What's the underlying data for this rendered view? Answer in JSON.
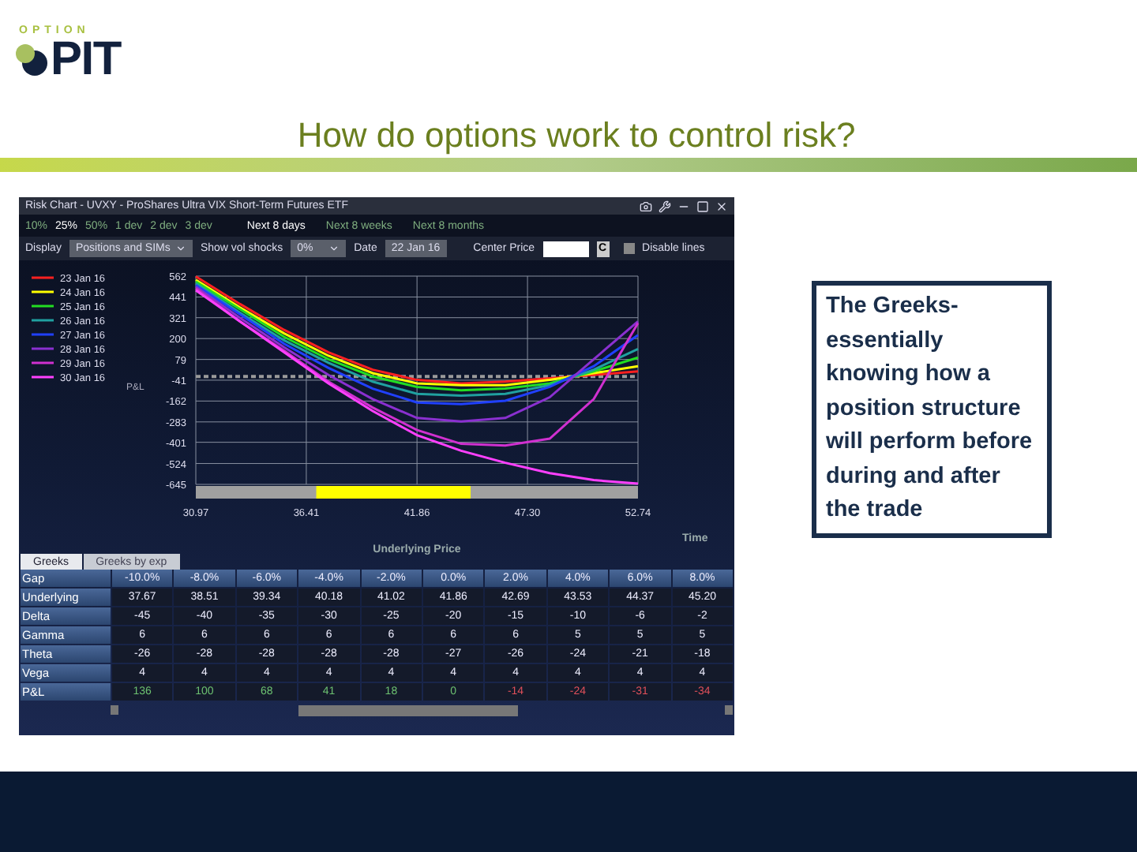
{
  "logo": {
    "top": "OPTION",
    "main": "PIT"
  },
  "title": "How do options work to control risk?",
  "risk_window": {
    "title": "Risk Chart - UVXY - ProShares Ultra VIX Short-Term Futures ETF",
    "ranges": [
      {
        "label": "10%",
        "selected": false
      },
      {
        "label": "25%",
        "selected": true
      },
      {
        "label": "50%",
        "selected": false
      },
      {
        "label": "1 dev",
        "selected": false
      },
      {
        "label": "2 dev",
        "selected": false
      },
      {
        "label": "3 dev",
        "selected": false
      }
    ],
    "horizons": [
      {
        "label": "Next 8 days",
        "selected": true
      },
      {
        "label": "Next 8 weeks",
        "selected": false
      },
      {
        "label": "Next 8 months",
        "selected": false
      }
    ],
    "controls": {
      "display_label": "Display",
      "display_value": "Positions and SIMs",
      "vol_label": "Show vol shocks",
      "vol_value": "0%",
      "date_label": "Date",
      "date_value": "22 Jan 16",
      "center_label": "Center Price",
      "center_button": "C",
      "disable_label": "Disable lines",
      "disable_checked": false
    },
    "chart_data": {
      "type": "line",
      "grid": true,
      "legend": true,
      "ref_lines": [
        {
          "axis": "y",
          "value": -20
        }
      ],
      "xlabel": "Underlying Price",
      "ylabel": "P&L",
      "x": [
        30.97,
        33.15,
        35.32,
        37.5,
        39.68,
        41.86,
        44.03,
        46.21,
        48.39,
        50.56,
        52.74
      ],
      "xlim": [
        30.97,
        52.74
      ],
      "ylim": [
        -645,
        562
      ],
      "xticks": [
        {
          "value": 30.97,
          "label": "30.97"
        },
        {
          "value": 36.41,
          "label": "36.41"
        },
        {
          "value": 41.86,
          "label": "41.86"
        },
        {
          "value": 47.3,
          "label": "47.30"
        },
        {
          "value": 52.74,
          "label": "52.74"
        }
      ],
      "yticks": [
        562,
        441,
        321,
        200,
        79,
        -41,
        -162,
        -283,
        -401,
        -524,
        -645
      ],
      "series": [
        {
          "name": "23 Jan 16",
          "color": "#ff2020",
          "values": [
            560,
            400,
            250,
            120,
            20,
            -40,
            -60,
            -50,
            -30,
            -10,
            10
          ]
        },
        {
          "name": "24 Jan 16",
          "color": "#ffff00",
          "values": [
            540,
            380,
            230,
            100,
            0,
            -60,
            -70,
            -70,
            -40,
            0,
            40
          ]
        },
        {
          "name": "25 Jan 16",
          "color": "#22dd22",
          "values": [
            530,
            370,
            210,
            80,
            -20,
            -80,
            -100,
            -90,
            -60,
            10,
            90
          ]
        },
        {
          "name": "26 Jan 16",
          "color": "#20a0a0",
          "values": [
            520,
            350,
            190,
            60,
            -50,
            -120,
            -130,
            -120,
            -70,
            20,
            140
          ]
        },
        {
          "name": "27 Jan 16",
          "color": "#2040ff",
          "values": [
            510,
            340,
            170,
            30,
            -90,
            -170,
            -180,
            -160,
            -80,
            40,
            220
          ]
        },
        {
          "name": "28 Jan 16",
          "color": "#8a30d0",
          "values": [
            500,
            320,
            150,
            -10,
            -150,
            -260,
            -280,
            -260,
            -140,
            80,
            300
          ]
        },
        {
          "name": "29 Jan 16",
          "color": "#d030d0",
          "values": [
            490,
            300,
            130,
            -50,
            -200,
            -330,
            -410,
            -420,
            -380,
            -150,
            290
          ]
        },
        {
          "name": "30 Jan 16",
          "color": "#ff40ff",
          "values": [
            480,
            300,
            120,
            -60,
            -220,
            -360,
            -450,
            -520,
            -580,
            -620,
            -640
          ]
        }
      ]
    },
    "time_label": "Time",
    "tabs": [
      {
        "label": "Greeks",
        "selected": true
      },
      {
        "label": "Greeks by exp",
        "selected": false
      }
    ],
    "table": {
      "rows": [
        {
          "label": "Gap",
          "kind": "header",
          "cells": [
            {
              "text": "-10.0%"
            },
            {
              "text": "-8.0%"
            },
            {
              "text": "-6.0%"
            },
            {
              "text": "-4.0%"
            },
            {
              "text": "-2.0%"
            },
            {
              "text": "0.0%"
            },
            {
              "text": "2.0%"
            },
            {
              "text": "4.0%"
            },
            {
              "text": "6.0%"
            },
            {
              "text": "8.0%"
            }
          ]
        },
        {
          "label": "Underlying",
          "kind": "data",
          "cells": [
            {
              "text": "37.67"
            },
            {
              "text": "38.51"
            },
            {
              "text": "39.34"
            },
            {
              "text": "40.18"
            },
            {
              "text": "41.02"
            },
            {
              "text": "41.86"
            },
            {
              "text": "42.69"
            },
            {
              "text": "43.53"
            },
            {
              "text": "44.37"
            },
            {
              "text": "45.20"
            }
          ]
        },
        {
          "label": "Delta",
          "kind": "data",
          "cells": [
            {
              "text": "-45"
            },
            {
              "text": "-40"
            },
            {
              "text": "-35"
            },
            {
              "text": "-30"
            },
            {
              "text": "-25"
            },
            {
              "text": "-20"
            },
            {
              "text": "-15"
            },
            {
              "text": "-10"
            },
            {
              "text": "-6"
            },
            {
              "text": "-2"
            }
          ]
        },
        {
          "label": "Gamma",
          "kind": "data",
          "cells": [
            {
              "text": "6"
            },
            {
              "text": "6"
            },
            {
              "text": "6"
            },
            {
              "text": "6"
            },
            {
              "text": "6"
            },
            {
              "text": "6"
            },
            {
              "text": "6"
            },
            {
              "text": "5"
            },
            {
              "text": "5"
            },
            {
              "text": "5"
            }
          ]
        },
        {
          "label": "Theta",
          "kind": "data",
          "cells": [
            {
              "text": "-26"
            },
            {
              "text": "-28"
            },
            {
              "text": "-28"
            },
            {
              "text": "-28"
            },
            {
              "text": "-28"
            },
            {
              "text": "-27"
            },
            {
              "text": "-26"
            },
            {
              "text": "-24"
            },
            {
              "text": "-21"
            },
            {
              "text": "-18"
            }
          ]
        },
        {
          "label": "Vega",
          "kind": "data",
          "cells": [
            {
              "text": "4"
            },
            {
              "text": "4"
            },
            {
              "text": "4"
            },
            {
              "text": "4"
            },
            {
              "text": "4"
            },
            {
              "text": "4"
            },
            {
              "text": "4"
            },
            {
              "text": "4"
            },
            {
              "text": "4"
            },
            {
              "text": "4"
            }
          ]
        },
        {
          "label": "P&L",
          "kind": "pnl",
          "cells": [
            {
              "text": "136",
              "loss": false
            },
            {
              "text": "100",
              "loss": false
            },
            {
              "text": "68",
              "loss": false
            },
            {
              "text": "41",
              "loss": false
            },
            {
              "text": "18",
              "loss": false
            },
            {
              "text": "0",
              "loss": false
            },
            {
              "text": "-14",
              "loss": true
            },
            {
              "text": "-24",
              "loss": true
            },
            {
              "text": "-31",
              "loss": true
            },
            {
              "text": "-34",
              "loss": true
            }
          ]
        }
      ]
    }
  },
  "note": "The Greeks- essentially knowing how a position structure will perform before during and after the trade"
}
